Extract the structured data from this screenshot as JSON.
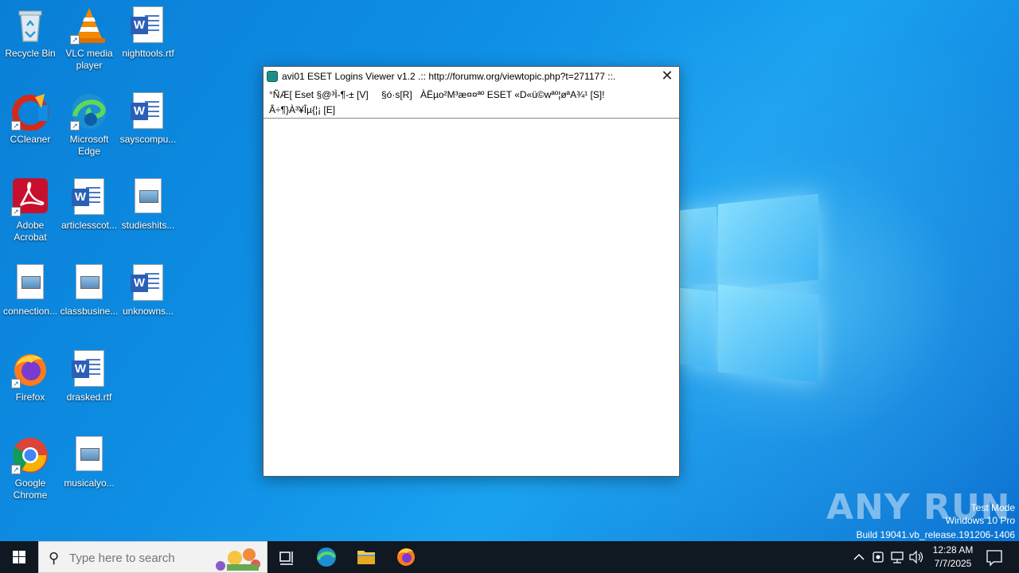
{
  "desktop": {
    "icons": [
      {
        "label": "Recycle Bin",
        "icon": "recycle-bin-icon"
      },
      {
        "label": "VLC media player",
        "icon": "vlc-icon"
      },
      {
        "label": "nighttools.rtf",
        "icon": "word-doc-icon"
      },
      {
        "label": "CCleaner",
        "icon": "ccleaner-icon"
      },
      {
        "label": "Microsoft Edge",
        "icon": "edge-icon"
      },
      {
        "label": "sayscompu...",
        "icon": "word-doc-icon"
      },
      {
        "label": "Adobe Acrobat",
        "icon": "acrobat-icon"
      },
      {
        "label": "articlesscot...",
        "icon": "word-doc-icon"
      },
      {
        "label": "studieshits...",
        "icon": "image-file-icon"
      },
      {
        "label": "connection...",
        "icon": "image-file-icon"
      },
      {
        "label": "classbusine...",
        "icon": "image-file-icon"
      },
      {
        "label": "unknowns...",
        "icon": "word-doc-icon"
      },
      {
        "label": "Firefox",
        "icon": "firefox-icon"
      },
      {
        "label": "drasked.rtf",
        "icon": "word-doc-icon"
      },
      {
        "label": "Google Chrome",
        "icon": "chrome-icon"
      },
      {
        "label": "musicalyo...",
        "icon": "image-file-icon"
      }
    ]
  },
  "window": {
    "title": "avi01 ESET Logins Viewer v1.2 .:: http://forumw.org/viewtopic.php?t=271177 ::.",
    "close_label": "✕",
    "menu": {
      "item1": "°ÑÆ[ Eset §@³Ì-¶-± [V]",
      "item2": "§ó·s[R]",
      "item3": "ÀËµo²M³æ¤¤ªº ESET «D«ü©wªº¦øªA¾¹ [S]!",
      "item4": "Â÷¶}À³¥Îµ{¦¡ [E]"
    }
  },
  "watermark": {
    "brand": "ANY RUN",
    "line1": "Test Mode",
    "line2": "Windows 10 Pro",
    "line3": "Build 19041.vb_release.191206-1406"
  },
  "taskbar": {
    "search_placeholder": "Type here to search",
    "time": "12:28 AM",
    "date": "7/7/2025"
  }
}
